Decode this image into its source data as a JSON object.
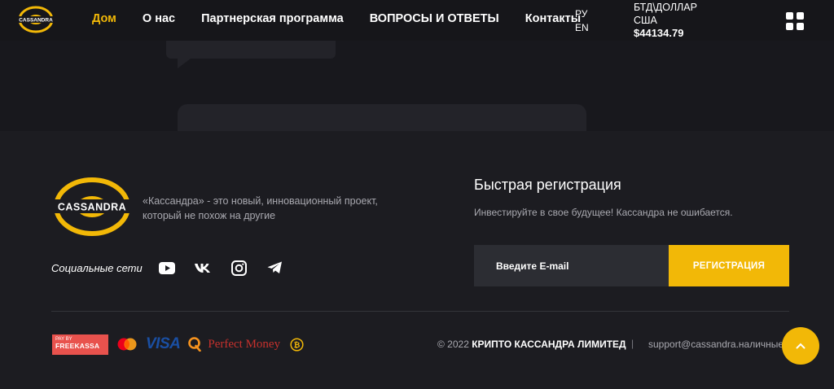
{
  "nav": {
    "logo_text": "CASSANDRA",
    "menu": [
      {
        "label": "Дом",
        "active": true
      },
      {
        "label": "О нас",
        "active": false
      },
      {
        "label": "Партнерская программа",
        "active": false
      },
      {
        "label": "ВОПРОСЫ И ОТВЕТЫ",
        "active": false
      },
      {
        "label": "Контакты",
        "active": false
      }
    ],
    "lang": [
      "РУ",
      "EN"
    ],
    "rate_label_1": "БТД\\ДОЛЛАР",
    "rate_label_2": "США",
    "rate_value": "$44134.79"
  },
  "footer": {
    "logo_text": "CASSANDRA",
    "description": "«Кассандра» - это новый, инновационный проект, который не похож на другие",
    "social_label": "Социальные сети",
    "social_icons": [
      "youtube-icon",
      "vk-icon",
      "instagram-icon",
      "telegram-icon"
    ],
    "registration": {
      "title": "Быстрая регистрация",
      "subtitle": "Инвестируйте в свое будущее! Кассандра не ошибается.",
      "email_placeholder": "Введите E-mail",
      "button_label": "РЕГИСТРАЦИЯ"
    },
    "payments": {
      "freekassa_top": "PAY BY",
      "freekassa_name": "FREEKASSA",
      "visa": "VISA",
      "perfect_money": "Perfect Money"
    },
    "copyright_prefix": "© 2022",
    "copyright_brand": "КРИПТО КАССАНДРА ЛИМИТЕД",
    "separator": "|",
    "support_email": "support@cassandra.наличные"
  },
  "colors": {
    "accent": "#f2b807",
    "background": "#1c1c21",
    "input_bg": "#2c2d33"
  }
}
